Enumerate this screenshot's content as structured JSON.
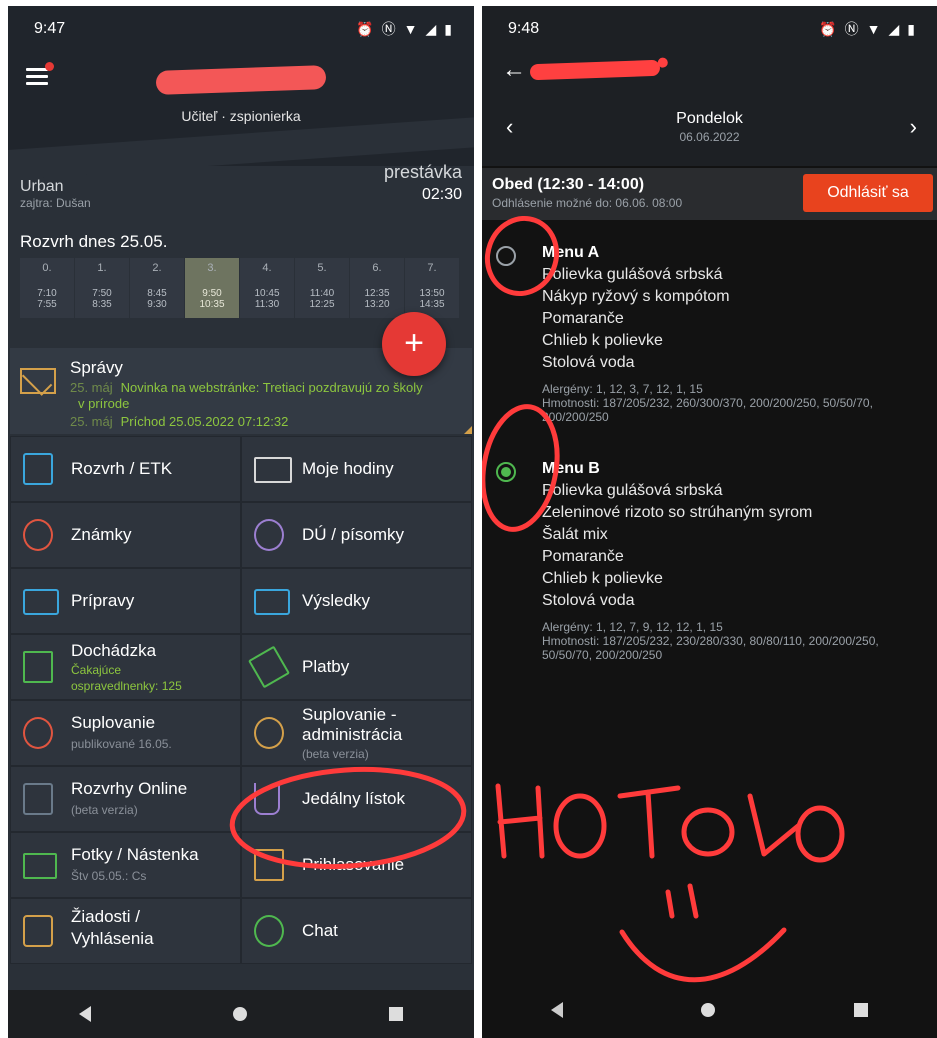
{
  "left": {
    "status": {
      "time": "9:47"
    },
    "header": {
      "subtitle": "Učiteľ · zspionierka"
    },
    "break": {
      "teacher": "Urban",
      "tomorrow": "zajtra: Dušan",
      "label": "prestávka",
      "time": "02:30"
    },
    "schedule": {
      "title": "Rozvrh dnes 25.05.",
      "active_index": 3,
      "slots": [
        {
          "num": "0.",
          "start": "7:10",
          "end": "7:55"
        },
        {
          "num": "1.",
          "start": "7:50",
          "end": "8:35"
        },
        {
          "num": "2.",
          "start": "8:45",
          "end": "9:30"
        },
        {
          "num": "3.",
          "start": "9:50",
          "end": "10:35"
        },
        {
          "num": "4.",
          "start": "10:45",
          "end": "11:30"
        },
        {
          "num": "5.",
          "start": "11:40",
          "end": "12:25"
        },
        {
          "num": "6.",
          "start": "12:35",
          "end": "13:20"
        },
        {
          "num": "7.",
          "start": "13:50",
          "end": "14:35"
        }
      ]
    },
    "fab_label": "+",
    "messages": {
      "title": "Správy",
      "items": [
        {
          "date": "25. máj",
          "text": "Novinka na webstránke: Tretiaci pozdravujú zo školy"
        },
        {
          "date": "",
          "text": "v prírode"
        },
        {
          "date": "25. máj",
          "text": "Príchod 25.05.2022 07:12:32"
        }
      ]
    },
    "tiles": [
      {
        "label": "Rozvrh / ETK",
        "sub": ""
      },
      {
        "label": "Moje hodiny",
        "sub": ""
      },
      {
        "label": "Známky",
        "sub": ""
      },
      {
        "label": "DÚ / písomky",
        "sub": ""
      },
      {
        "label": "Prípravy",
        "sub": ""
      },
      {
        "label": "Výsledky",
        "sub": ""
      },
      {
        "label": "Dochádzka",
        "sub": "Čakajúce",
        "sub2": "ospravedlnenky: 125"
      },
      {
        "label": "Platby",
        "sub": ""
      },
      {
        "label": "Suplovanie",
        "sub": "publikované 16.05."
      },
      {
        "label": "Suplovanie -",
        "label2": "administrácia",
        "sub": "(beta verzia)"
      },
      {
        "label": "Rozvrhy Online",
        "sub": "(beta verzia)"
      },
      {
        "label": "Jedálny lístok",
        "sub": ""
      },
      {
        "label": "Fotky / Nástenka",
        "sub": "Štv 05.05.: Cs"
      },
      {
        "label": "Prihlasovanie",
        "sub": ""
      },
      {
        "label": "Žiadosti /",
        "label2": "Vyhlásenia",
        "sub": ""
      },
      {
        "label": "Chat",
        "sub": ""
      }
    ]
  },
  "right": {
    "status": {
      "time": "9:48"
    },
    "day": {
      "name": "Pondelok",
      "date": "06.06.2022"
    },
    "lunch": {
      "title": "Obed (12:30 - 14:00)",
      "note": "Odhlásenie možné do: 06.06. 08:00",
      "button": "Odhlásiť sa"
    },
    "menus": [
      {
        "name": "Menu A",
        "selected": false,
        "items": [
          "Polievka gulášová srbská",
          "Nákyp ryžový s kompótom",
          "Pomaranče",
          "Chlieb k polievke",
          "Stolová voda"
        ],
        "allergens": "Alergény: 1, 12, 3, 7, 12, 1, 15",
        "weights": "Hmotnosti: 187/205/232, 260/300/370, 200/200/250, 50/50/70, 200/200/250"
      },
      {
        "name": "Menu B",
        "selected": true,
        "items": [
          "Polievka gulášová srbská",
          "Zeleninové rizoto so strúhaným syrom",
          "Šalát mix",
          "Pomaranče",
          "Chlieb k polievke",
          "Stolová voda"
        ],
        "allergens": "Alergény: 1, 12, 7, 9, 12, 12, 1, 15",
        "weights": "Hmotnosti: 187/205/232, 230/280/330, 80/80/110, 200/200/250, 50/50/70, 200/200/250"
      }
    ],
    "handwriting": "HOTOVO"
  },
  "colors": {
    "accent": "#e53935",
    "signout": "#e8431e",
    "green": "#8dc63f",
    "annotation": "#ff3b3b"
  }
}
